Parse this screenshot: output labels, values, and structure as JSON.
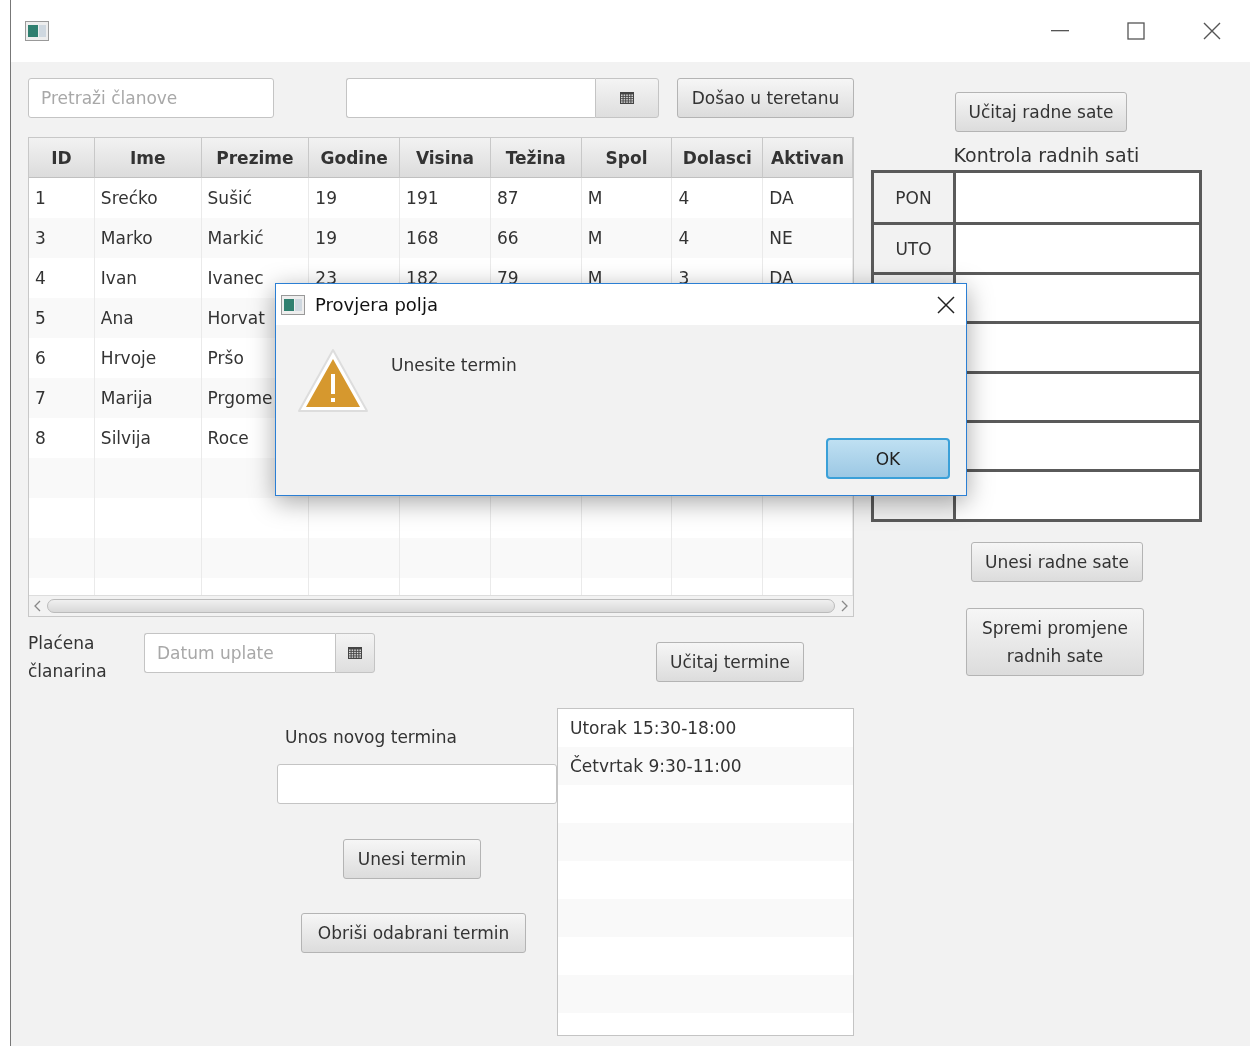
{
  "search": {
    "placeholder": "Pretraži članove"
  },
  "top_button": "Došao u teretanu",
  "table": {
    "columns": [
      "ID",
      "Ime",
      "Prezime",
      "Godine",
      "Visina",
      "Težina",
      "Spol",
      "Dolasci",
      "Aktivan"
    ],
    "rows": [
      [
        "1",
        "Srećko",
        "Sušić",
        "19",
        "191",
        "87",
        "M",
        "4",
        "DA"
      ],
      [
        "3",
        "Marko",
        "Markić",
        "19",
        "168",
        "66",
        "M",
        "4",
        "NE"
      ],
      [
        "4",
        "Ivan",
        "Ivanec",
        "23",
        "182",
        "79",
        "M",
        "3",
        "DA"
      ],
      [
        "5",
        "Ana",
        "Horvat"
      ],
      [
        "6",
        "Hrvoje",
        "Pršo"
      ],
      [
        "7",
        "Marija",
        "Prgome"
      ],
      [
        "8",
        "Silvija",
        "Roce"
      ]
    ]
  },
  "payment": {
    "label": "Plaćena članarina",
    "placeholder": "Datum uplate"
  },
  "load_terms_button": "Učitaj termine",
  "new_term": {
    "label": "Unos novog termina",
    "add_button": "Unesi termin",
    "delete_button": "Obriši odabrani termin"
  },
  "terms": [
    "Utorak 15:30-18:00",
    "Četvrtak 9:30-11:00"
  ],
  "hours": {
    "load_button": "Učitaj radne sate",
    "title": "Kontrola radnih sati",
    "rows": [
      {
        "day": "PON"
      },
      {
        "day": "UTO"
      },
      {},
      {},
      {},
      {},
      {}
    ],
    "enter_button": "Unesi radne sate",
    "save_button": "Spremi promjene radnih sate"
  },
  "dialog": {
    "title": "Provjera polja",
    "message": "Unesite termin",
    "ok": "OK"
  }
}
